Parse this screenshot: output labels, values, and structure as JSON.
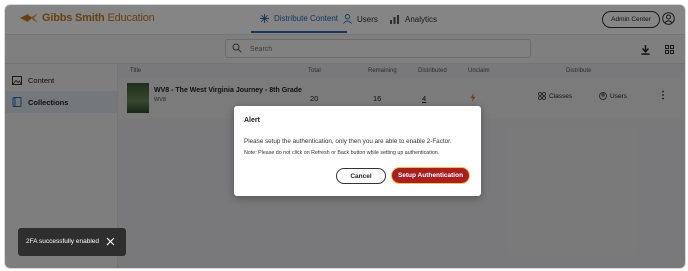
{
  "brand": {
    "name_bold": "Gibbs Smith",
    "name_light": " Education",
    "color": "#c47d22"
  },
  "nav": {
    "tabs": [
      {
        "label": "Distribute Content",
        "icon": "sparkle-icon",
        "active": true
      },
      {
        "label": "Users",
        "icon": "person-icon"
      },
      {
        "label": "Analytics",
        "icon": "bar-chart-icon"
      }
    ],
    "admin_label": "Admin Center"
  },
  "toolbar": {
    "search_placeholder": "Search"
  },
  "sidebar": {
    "items": [
      {
        "label": "Content",
        "icon": "photo-icon"
      },
      {
        "label": "Collections",
        "icon": "book-icon",
        "active": true
      }
    ]
  },
  "table": {
    "headers": {
      "title": "Title",
      "total": "Total",
      "remaining": "Remaining",
      "distributed": "Distributed",
      "unclaim": "Unclaim",
      "distribute": "Distribute"
    },
    "rows": [
      {
        "title": "WV8 - The West Virginia Journey - 8th Grade",
        "code": "WV8",
        "total": "20",
        "remaining": "16",
        "distributed": "4",
        "classes_label": "Classes",
        "users_label": "Users",
        "more": "⋮"
      }
    ]
  },
  "modal": {
    "title": "Alert",
    "message": "Please setup the authentication, only then you are able to enable 2-Factor.",
    "note": "Note: Please do not click on Refresh or Back button while setting up authentication.",
    "cancel_label": "Cancel",
    "confirm_label": "Setup Authentication",
    "accent": "#a81f1f"
  },
  "toast": {
    "message": "2FA successfully enabled"
  }
}
